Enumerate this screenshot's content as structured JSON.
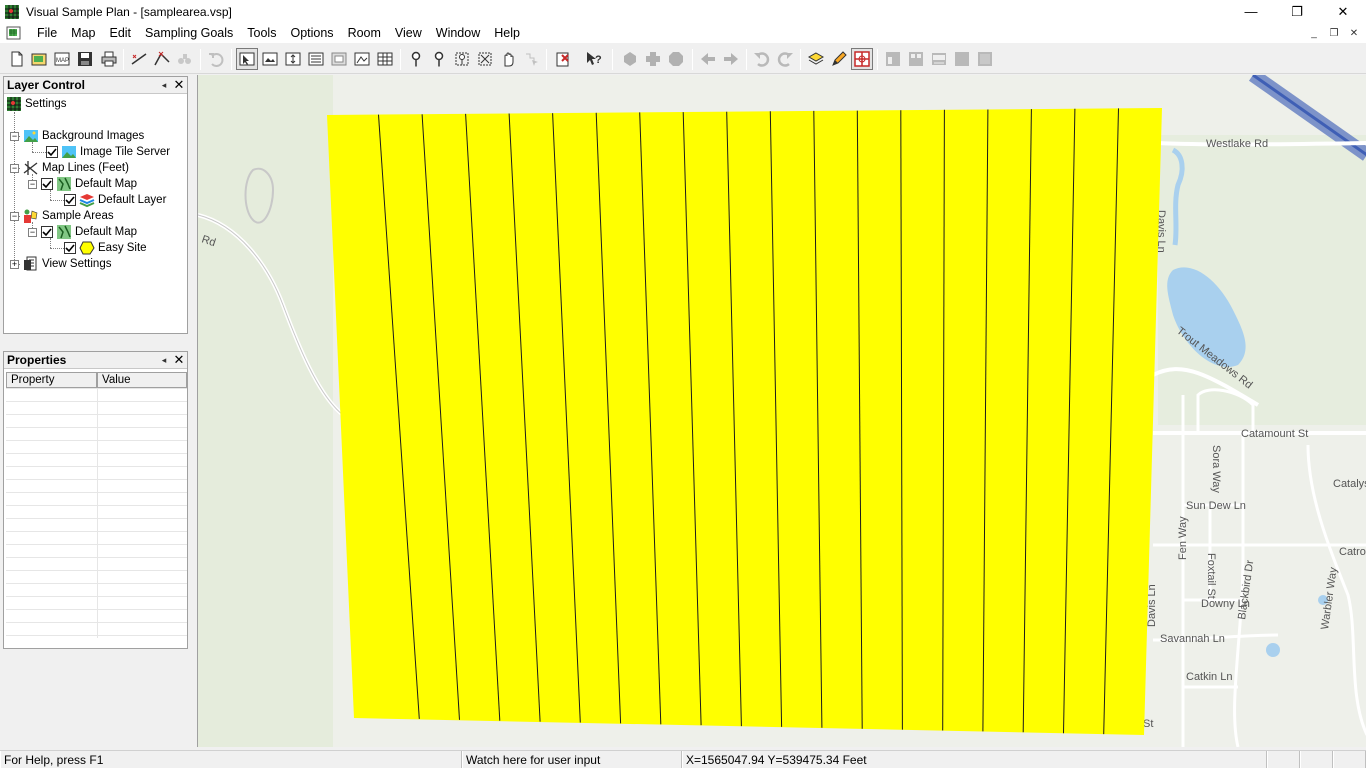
{
  "window": {
    "title": "Visual Sample Plan - [samplearea.vsp]",
    "minimize": "—",
    "restore": "❐",
    "close": "✕"
  },
  "menu": [
    "File",
    "Map",
    "Edit",
    "Sampling Goals",
    "Tools",
    "Options",
    "Room",
    "View",
    "Window",
    "Help"
  ],
  "mdi": {
    "minimize": "_",
    "restore": "❐",
    "close": "✕"
  },
  "layer_control": {
    "title": "Layer Control",
    "pin": "◂",
    "close": "✕",
    "tree": {
      "settings": "Settings",
      "background_images": "Background Images",
      "image_tile_server": "Image Tile Server",
      "map_lines": "Map Lines (Feet)",
      "map_lines_default_map": "Default Map",
      "default_layer": "Default Layer",
      "sample_areas": "Sample Areas",
      "sample_areas_default_map": "Default Map",
      "easy_site": "Easy Site",
      "view_settings": "View Settings"
    }
  },
  "properties": {
    "title": "Properties",
    "pin": "◂",
    "close": "✕",
    "col_property": "Property",
    "col_value": "Value"
  },
  "map": {
    "roads": {
      "westlake": "Westlake Rd",
      "rd_left": "Rd",
      "trout_meadows": "Trout Meadows Rd",
      "catamount": "Catamount St",
      "catalyst": "Catalys",
      "sora": "Sora Way",
      "sun_dew": "Sun Dew Ln",
      "fen": "Fen Way",
      "foxtail": "Foxtail St",
      "blackbird": "Blackbird Dr",
      "catro": "Catro",
      "warbler": "Warbler Way",
      "downy": "Downy Ln",
      "davis": "Davis Ln",
      "savannah": "Savannah Ln",
      "catkin": "Catkin Ln",
      "st": "St",
      "davis_top": "Davis Ln"
    },
    "colors": {
      "sample_area": "#ffff00",
      "grid_line": "#1a1a1a",
      "base": "#eef0ea",
      "park": "#e4ecd8",
      "water": "#a9d0ee"
    }
  },
  "status": {
    "help": "For Help, press F1",
    "user_input": "Watch here for user input",
    "coords": "X=1565047.94 Y=539475.34 Feet"
  }
}
